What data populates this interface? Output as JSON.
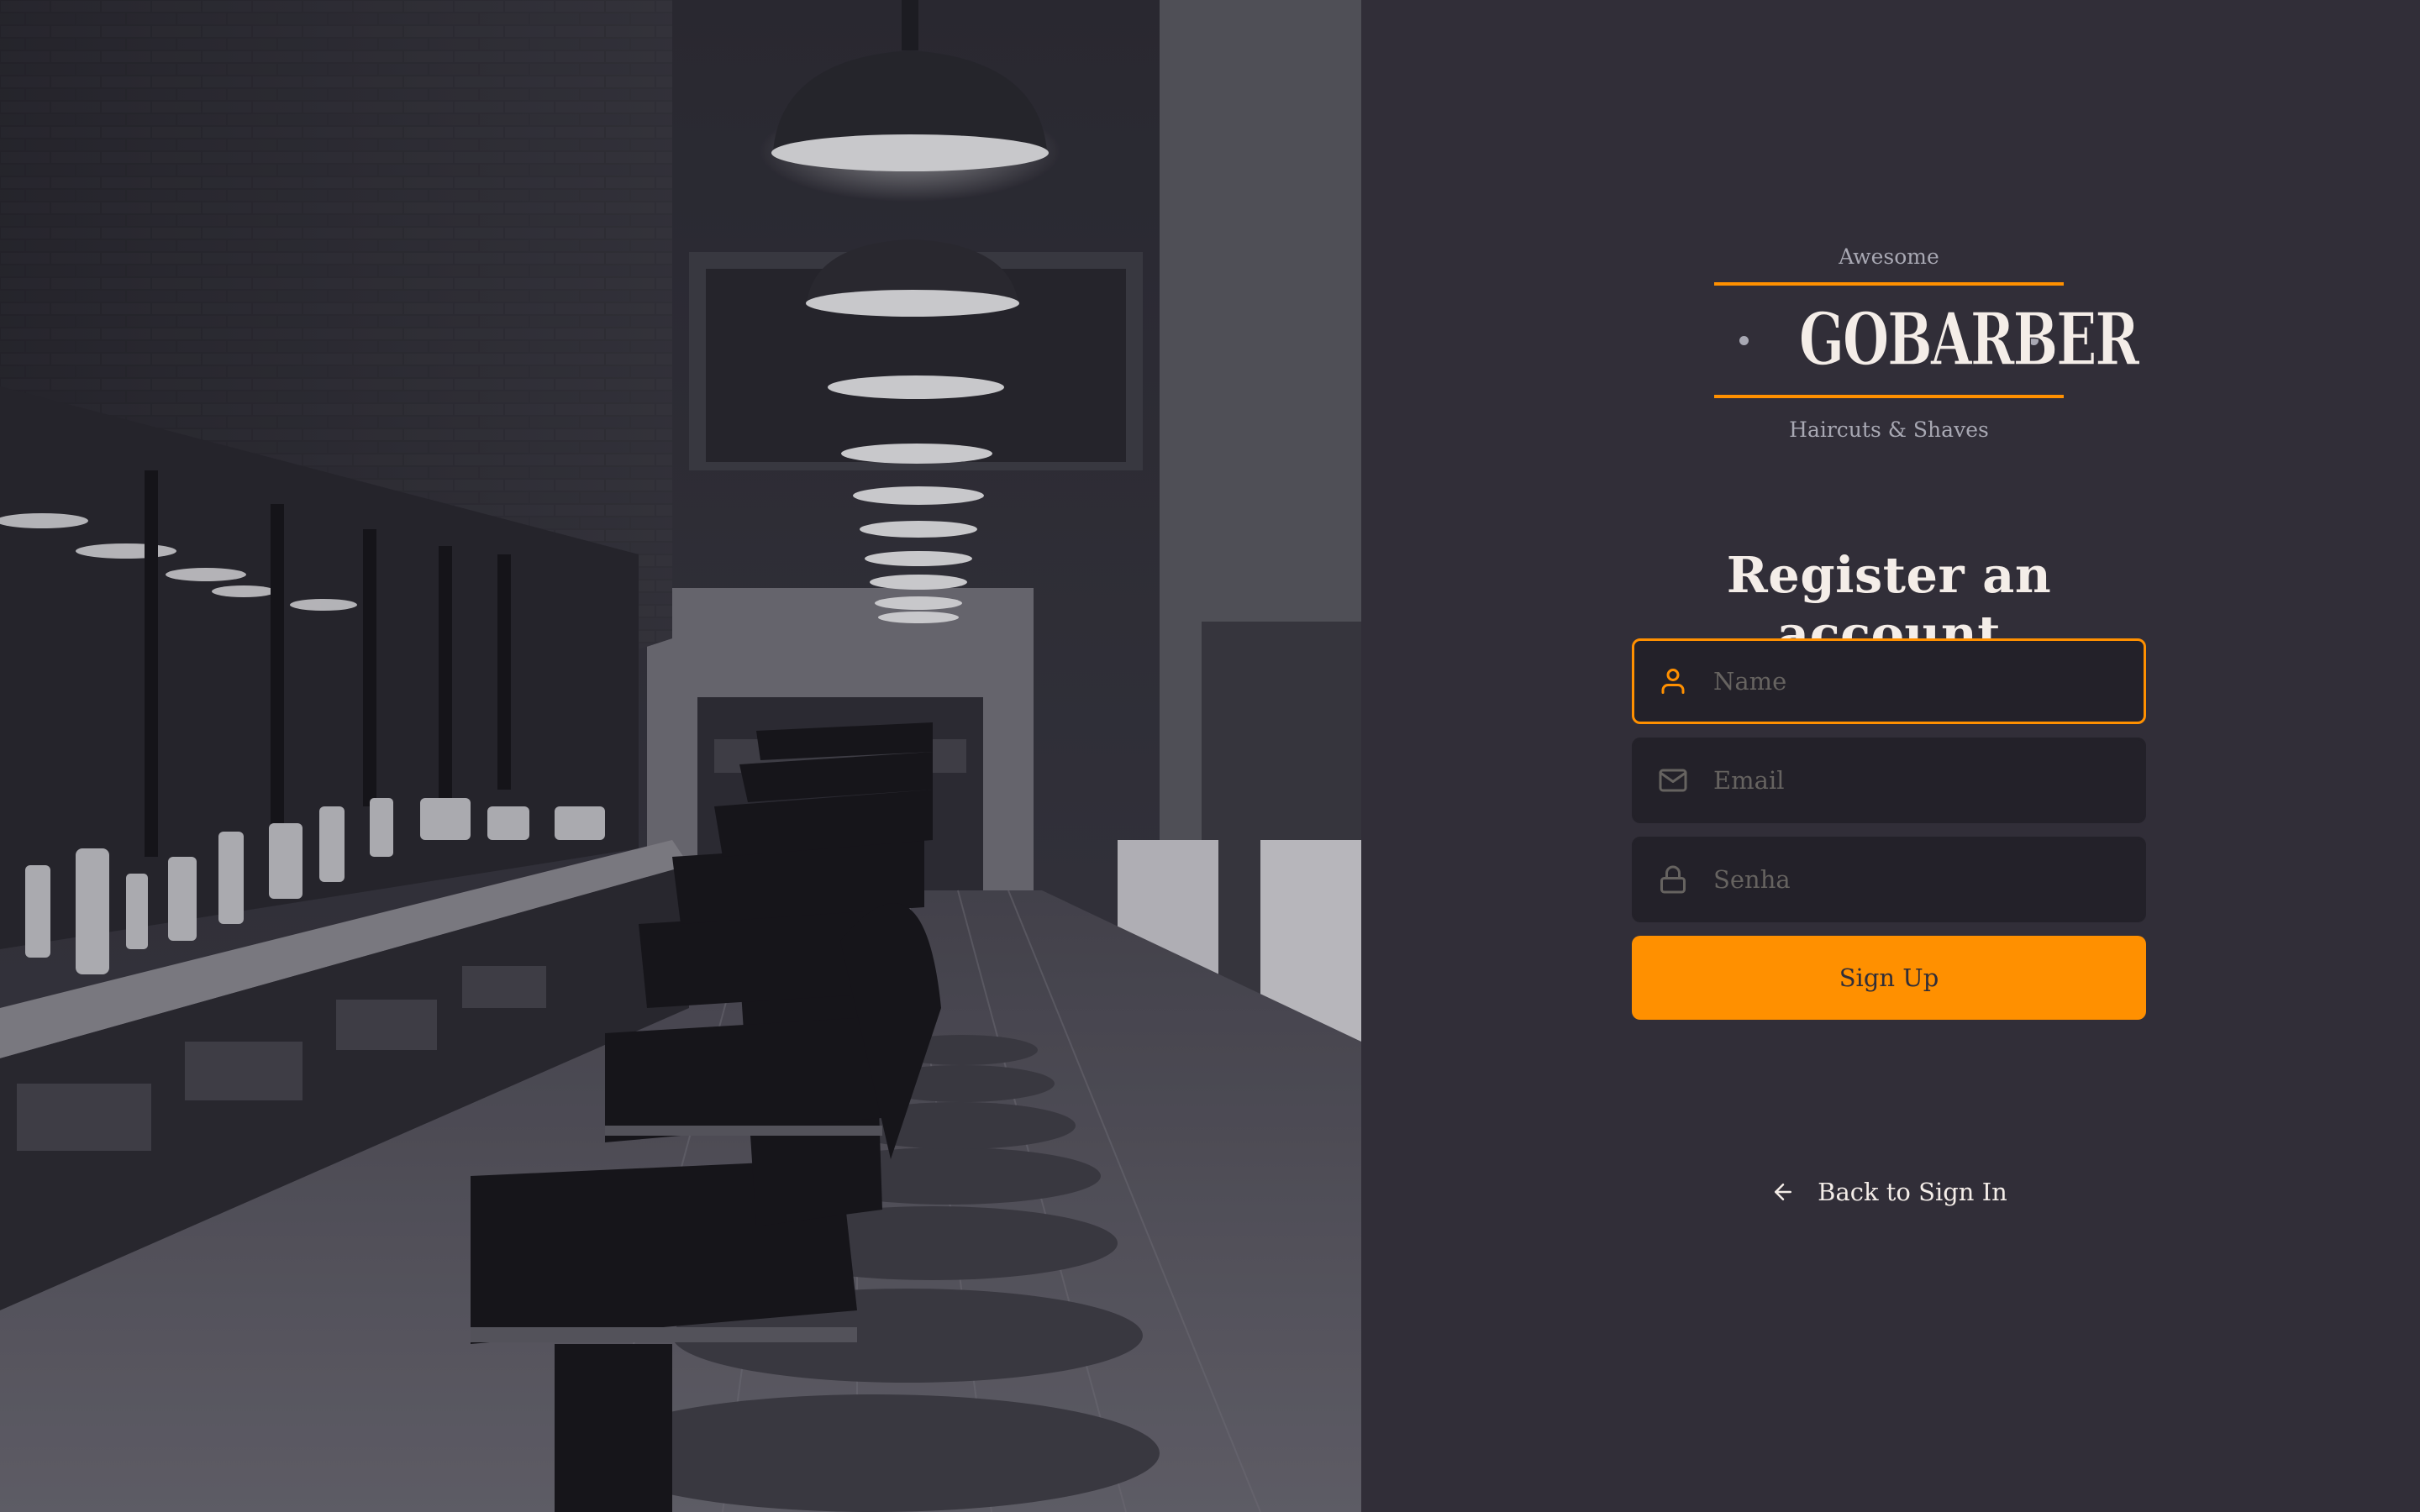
{
  "hero": {
    "image_alt": "Barbershop interior with a row of barber chairs and pendant lamps"
  },
  "logo": {
    "top_text": "Awesome",
    "wordmark": "GOBARBER",
    "bottom_text": "Haircuts & Shaves"
  },
  "form": {
    "title": "Register an account",
    "name_placeholder": "Name",
    "email_placeholder": "Email",
    "password_placeholder": "Senha",
    "submit_label": "Sign Up",
    "icons": [
      "user-icon",
      "mail-icon",
      "lock-icon"
    ]
  },
  "back_link": {
    "label": "Back to Sign In",
    "icon": "arrow-left-icon"
  },
  "colors": {
    "background": "#312e38",
    "input_background": "#232129",
    "accent": "#ff9000",
    "text": "#f4ede8",
    "muted": "#a8a8b3",
    "placeholder": "#666360"
  }
}
